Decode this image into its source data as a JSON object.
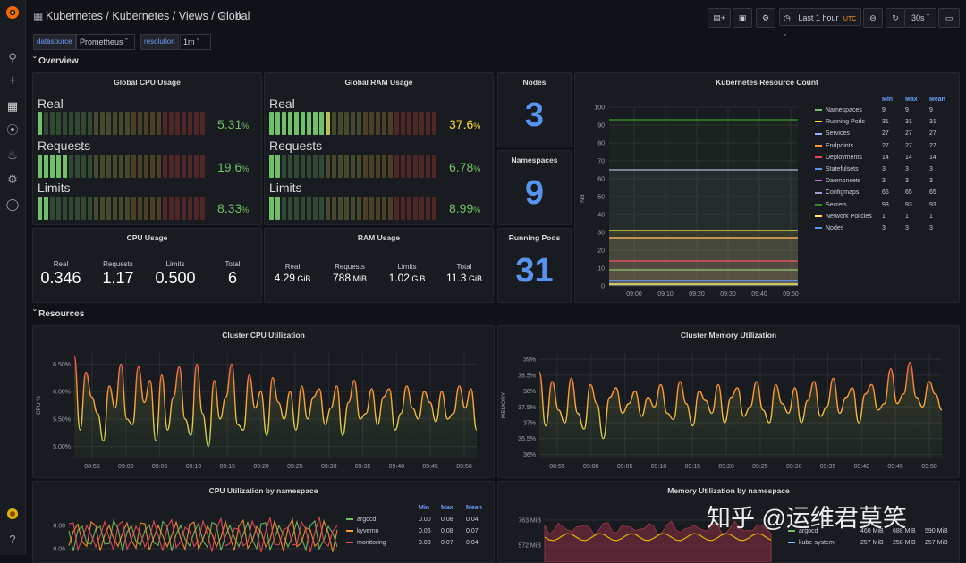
{
  "breadcrumb": {
    "part1": "Kubernetes",
    "part2": "/ Kubernetes / Views / Global"
  },
  "toolbar": {
    "time_range": "Last 1 hour",
    "tz": "UTC",
    "refresh": "30s"
  },
  "vars": [
    {
      "label": "datasource",
      "value": "Prometheus"
    },
    {
      "label": "resolution",
      "value": "1m"
    }
  ],
  "rows": {
    "overview": "Overview",
    "resources": "Resources"
  },
  "global_cpu": {
    "title": "Global CPU Usage",
    "gauges": [
      {
        "label": "Real",
        "value": "5.31",
        "unit": "%",
        "fill": 0.0531
      },
      {
        "label": "Requests",
        "value": "19.6",
        "unit": "%",
        "fill": 0.196
      },
      {
        "label": "Limits",
        "value": "8.33",
        "unit": "%",
        "fill": 0.0833
      }
    ]
  },
  "global_ram": {
    "title": "Global RAM Usage",
    "gauges": [
      {
        "label": "Real",
        "value": "37.6",
        "unit": "%",
        "fill": 0.376
      },
      {
        "label": "Requests",
        "value": "6.78",
        "unit": "%",
        "fill": 0.0678
      },
      {
        "label": "Limits",
        "value": "8.99",
        "unit": "%",
        "fill": 0.0899
      }
    ]
  },
  "nodes": {
    "title": "Nodes",
    "value": "3"
  },
  "namespaces": {
    "title": "Namespaces",
    "value": "9"
  },
  "running_pods": {
    "title": "Running Pods",
    "value": "31"
  },
  "cpu_usage": {
    "title": "CPU Usage",
    "stats": [
      {
        "label": "Real",
        "value": "0.346",
        "unit": ""
      },
      {
        "label": "Requests",
        "value": "1.17",
        "unit": ""
      },
      {
        "label": "Limits",
        "value": "0.500",
        "unit": ""
      },
      {
        "label": "Total",
        "value": "6",
        "unit": ""
      }
    ]
  },
  "ram_usage": {
    "title": "RAM Usage",
    "stats": [
      {
        "label": "Real",
        "value": "4.29",
        "unit": "GiB"
      },
      {
        "label": "Requests",
        "value": "788",
        "unit": "MiB"
      },
      {
        "label": "Limits",
        "value": "1.02",
        "unit": "GiB"
      },
      {
        "label": "Total",
        "value": "11.3",
        "unit": "GiB"
      }
    ]
  },
  "chart_data": [
    {
      "type": "line",
      "title": "Kubernetes Resource Count",
      "ylabel": "NB",
      "ylim": [
        0,
        100
      ],
      "yticks": [
        "0",
        "10",
        "20",
        "30",
        "40",
        "50",
        "60",
        "70",
        "80",
        "90",
        "100"
      ],
      "xticks": [
        "09:00",
        "09:10",
        "09:20",
        "09:30",
        "09:40",
        "09:50"
      ],
      "legend_headers": [
        "Min",
        "Max",
        "Mean"
      ],
      "series": [
        {
          "name": "Namespaces",
          "color": "#73bf69",
          "min": "9",
          "max": "9",
          "mean": "9",
          "value": 9
        },
        {
          "name": "Running Pods",
          "color": "#fade2a",
          "min": "31",
          "max": "31",
          "mean": "31",
          "value": 31
        },
        {
          "name": "Services",
          "color": "#8ab8ff",
          "min": "27",
          "max": "27",
          "mean": "27",
          "value": 27
        },
        {
          "name": "Endpoints",
          "color": "#ff9830",
          "min": "27",
          "max": "27",
          "mean": "27",
          "value": 27
        },
        {
          "name": "Deployments",
          "color": "#f2495c",
          "min": "14",
          "max": "14",
          "mean": "14",
          "value": 14
        },
        {
          "name": "Statefulsets",
          "color": "#5794f2",
          "min": "3",
          "max": "3",
          "mean": "3",
          "value": 3
        },
        {
          "name": "Daemonsets",
          "color": "#b877d9",
          "min": "3",
          "max": "3",
          "mean": "3",
          "value": 3
        },
        {
          "name": "Configmaps",
          "color": "#a0a0c8",
          "min": "65",
          "max": "65",
          "mean": "65",
          "value": 65
        },
        {
          "name": "Secrets",
          "color": "#37872d",
          "min": "93",
          "max": "93",
          "mean": "93",
          "value": 93
        },
        {
          "name": "Network Policies",
          "color": "#ffee52",
          "min": "1",
          "max": "1",
          "mean": "1",
          "value": 1
        },
        {
          "name": "Nodes",
          "color": "#5794f2",
          "min": "3",
          "max": "3",
          "mean": "3",
          "value": 3
        }
      ]
    },
    {
      "type": "line",
      "title": "Cluster CPU Utilization",
      "ylabel": "CPU %",
      "ylim": [
        4.8,
        6.7
      ],
      "yticks": [
        "5.00%",
        "5.50%",
        "6.00%",
        "6.50%"
      ],
      "ytick_values": [
        5.0,
        5.5,
        6.0,
        6.5
      ],
      "xticks": [
        "08:55",
        "09:00",
        "09:05",
        "09:10",
        "09:15",
        "09:20",
        "09:25",
        "09:30",
        "09:35",
        "09:40",
        "09:45",
        "09:50"
      ],
      "values": [
        6.65,
        5.3,
        6.35,
        5.9,
        5.6,
        5.1,
        6.1,
        5.7,
        6.5,
        5.5,
        5.4,
        6.45,
        5.8,
        6.2,
        5.1,
        6.3,
        5.3,
        5.9,
        6.45,
        5.5,
        5.2,
        6.5,
        5.6,
        5.0,
        6.2,
        5.5,
        5.9,
        6.5,
        5.4,
        5.3,
        6.3,
        5.7,
        6.0,
        5.2,
        6.25,
        5.8,
        5.5,
        6.0,
        5.3,
        6.1,
        5.5,
        5.9,
        6.05,
        5.4,
        5.7,
        6.1,
        5.2,
        5.8,
        6.2,
        5.5,
        5.6,
        6.05,
        5.4,
        5.9,
        6.05,
        5.3,
        5.6,
        6.1,
        5.7,
        5.5,
        6.0,
        5.8,
        5.45,
        6.0,
        5.5,
        5.6,
        6.1,
        5.7,
        6.05,
        5.3
      ]
    },
    {
      "type": "line",
      "title": "Cluster Memory Utilization",
      "ylabel": "MEMORY",
      "ylim": [
        35.9,
        39.2
      ],
      "yticks": [
        "36%",
        "36.5%",
        "37%",
        "37.5%",
        "38%",
        "38.5%",
        "39%"
      ],
      "ytick_values": [
        36,
        36.5,
        37,
        37.5,
        38,
        38.5,
        39
      ],
      "xticks": [
        "08:55",
        "09:00",
        "09:05",
        "09:10",
        "09:15",
        "09:20",
        "09:25",
        "09:30",
        "09:35",
        "09:40",
        "09:45",
        "09:50"
      ],
      "values": [
        38.6,
        36.9,
        38.3,
        37.4,
        37.0,
        38.4,
        37.3,
        36.8,
        38.2,
        37.6,
        36.5,
        37.8,
        38.1,
        37.3,
        37.6,
        38.0,
        37.2,
        37.8,
        37.5,
        38.2,
        37.3,
        37.1,
        38.3,
        37.6,
        36.9,
        38.0,
        37.7,
        37.3,
        38.2,
        37.0,
        37.8,
        38.1,
        37.2,
        37.5,
        38.3,
        37.4,
        37.0,
        38.2,
        37.6,
        37.3,
        38.1,
        37.0,
        37.7,
        38.3,
        37.2,
        37.5,
        38.4,
        37.3,
        37.8,
        38.1,
        37.0,
        37.9,
        38.2,
        37.4,
        37.6,
        38.7,
        37.6,
        37.9,
        38.9,
        37.8,
        37.5,
        38.3,
        37.9,
        37.4
      ]
    },
    {
      "type": "line",
      "title": "CPU Utilization by namespace",
      "yticks": [
        "0.06",
        "0.08"
      ],
      "legend_headers": [
        "Min",
        "Max",
        "Mean"
      ],
      "series": [
        {
          "name": "argocd",
          "color": "#73bf69",
          "min": "0.00",
          "max": "0.08",
          "mean": "0.04"
        },
        {
          "name": "kyverno",
          "color": "#ff9830",
          "min": "0.06",
          "max": "0.08",
          "mean": "0.07"
        },
        {
          "name": "monitoring",
          "color": "#f2495c",
          "min": "0.03",
          "max": "0.07",
          "mean": "0.04"
        }
      ]
    },
    {
      "type": "line",
      "title": "Memory Utilization by namespace",
      "yticks": [
        "572 MiB",
        "763 MiB"
      ],
      "series": [
        {
          "name": "argocd",
          "color": "#73bf69",
          "min": "460 MiB",
          "max": "688 MiB",
          "mean": "590 MiB"
        },
        {
          "name": "kube-system",
          "color": "#8ab8ff",
          "min": "257 MiB",
          "max": "258 MiB",
          "mean": "257 MiB"
        }
      ]
    }
  ],
  "watermark": "知乎 @运维君莫笑"
}
